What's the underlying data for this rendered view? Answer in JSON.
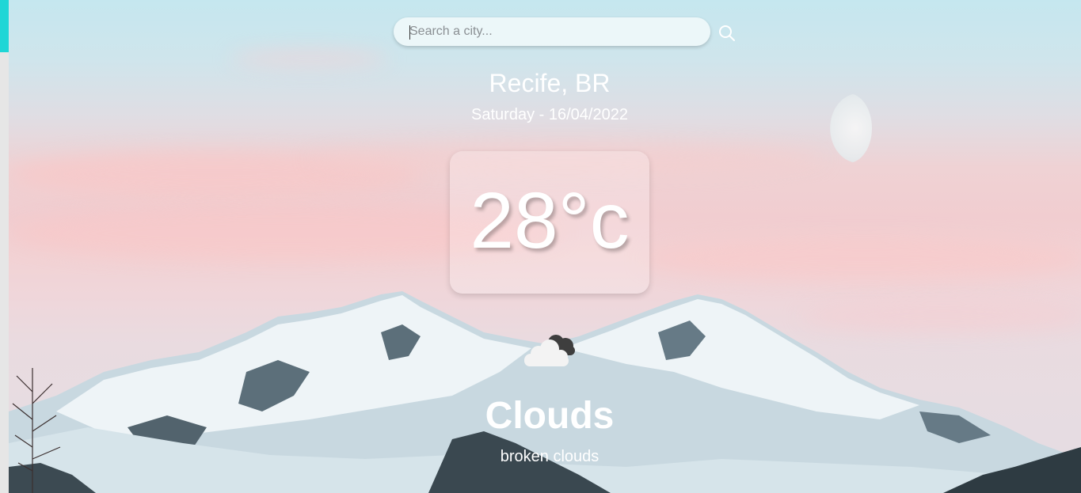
{
  "search": {
    "placeholder": "Search a city...",
    "value": "",
    "button_icon": "search-icon"
  },
  "location": {
    "city_label": "Recife, BR"
  },
  "date_label": "Saturday - 16/04/2022",
  "temperature": {
    "display": "28°c"
  },
  "weather": {
    "icon": "broken-clouds-icon",
    "condition": "Clouds",
    "description": "broken clouds"
  },
  "colors": {
    "accent": "#1fd6d6",
    "text": "#ffffff"
  }
}
